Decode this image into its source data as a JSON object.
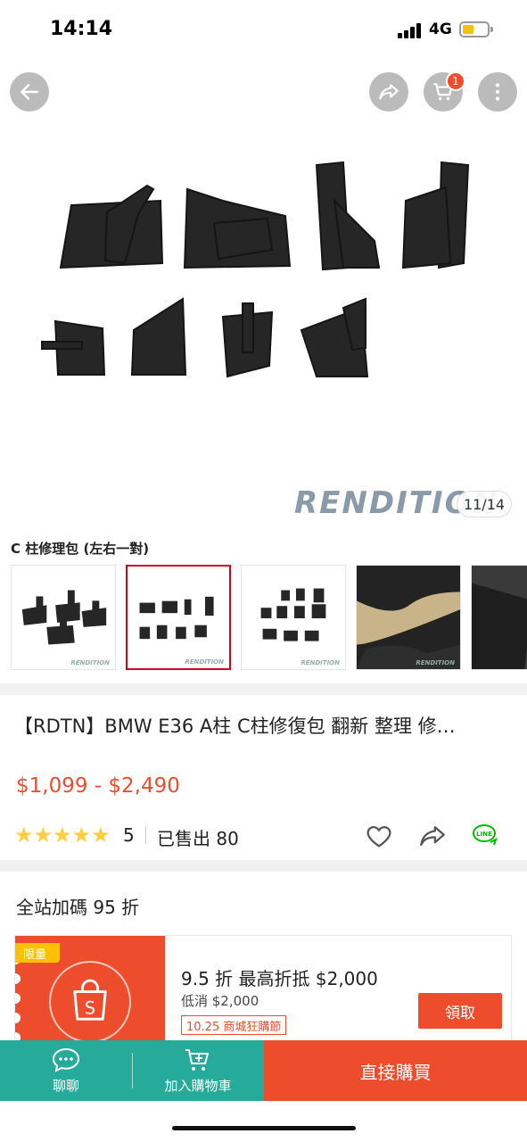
{
  "status_bar": {
    "time": "14:14",
    "network": "4G"
  },
  "cart": {
    "badge_count": "1"
  },
  "gallery": {
    "brand_watermark": "RENDITION",
    "counter": "11/14"
  },
  "variant": {
    "label": "C 柱修理包 (左右一對)"
  },
  "product": {
    "title": "【RDTN】BMW E36 A柱 C柱修復包 翻新 整理 修…",
    "price": "$1,099 - $2,490",
    "rating_count": "5",
    "sold": "已售出 80",
    "stars": "★★★★★"
  },
  "coupons": {
    "header": "全站加碼 95 折",
    "limit_tag": "限量",
    "title": "9.5 折 最高折抵 $2,000",
    "min_spend": "低消 $2,000",
    "event_tag": "10.25 商城狂購節",
    "claim_label": "領取"
  },
  "bottom_bar": {
    "chat_label": "聊聊",
    "cart_label": "加入購物車",
    "buy_label": "直接購買"
  },
  "colors": {
    "accent": "#ee4d2d",
    "teal": "#26aa99",
    "star": "#ffce3d"
  }
}
